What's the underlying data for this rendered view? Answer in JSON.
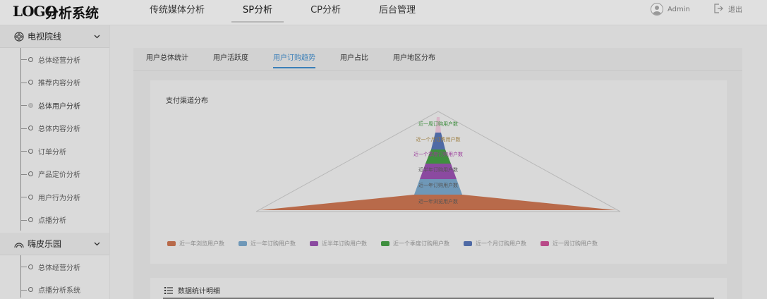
{
  "header": {
    "logo": "LOGO",
    "app_name": "分析系统",
    "nav": [
      "传统媒体分析",
      "SP分析",
      "CP分析",
      "后台管理"
    ],
    "nav_active_index": 1,
    "user": "Admin",
    "logout": "退出"
  },
  "sidebar": {
    "groups": [
      {
        "title": "电视院线",
        "icon": "film-reel-icon",
        "items": [
          "总体经营分析",
          "推荐内容分析",
          "总体用户分析",
          "总体内容分析",
          "订单分析",
          "产品定价分析",
          "用户行为分析",
          "点播分析"
        ],
        "active_index": 2
      },
      {
        "title": "嗨皮乐园",
        "icon": "rainbow-icon",
        "items": [
          "总体经营分析",
          "点播分析系统"
        ]
      }
    ]
  },
  "tabs": {
    "items": [
      "用户总体统计",
      "用户活跃度",
      "用户订购趋势",
      "用户占比",
      "用户地区分布"
    ],
    "active_index": 2
  },
  "chart_card": {
    "title": "支付渠道分布"
  },
  "detail_card": {
    "title": "数据统计明细",
    "icon": "list-icon"
  },
  "chart_data": {
    "type": "funnel",
    "title": "支付渠道分布",
    "stages": [
      {
        "name": "近一周订购用户数",
        "color": "#d9b8c9"
      },
      {
        "name": "近一个月订购用户数",
        "color": "#4f6aa5"
      },
      {
        "name": "近一个季度订购用户数",
        "color": "#3f8f3f"
      },
      {
        "name": "近半年订购用户数",
        "color": "#8b4aa0"
      },
      {
        "name": "近一年订购用户数",
        "color": "#6f98b8"
      },
      {
        "name": "近一年浏览用户数",
        "color": "#b86a4a"
      }
    ],
    "legend": {
      "placement": "bottom",
      "entries": [
        {
          "name": "近一年浏览用户数",
          "color": "#b86a4a"
        },
        {
          "name": "近一年订购用户数",
          "color": "#6f98b8"
        },
        {
          "name": "近半年订购用户数",
          "color": "#8b4aa0"
        },
        {
          "name": "近一个季度订购用户数",
          "color": "#3f8f3f"
        },
        {
          "name": "近一个月订购用户数",
          "color": "#4f6aa5"
        },
        {
          "name": "近一周订购用户数",
          "color": "#b84a88"
        }
      ]
    },
    "label_colors": {
      "近一周订购用户数": "#3a8a3a",
      "近一个月订购用户数": "#9a7a3a",
      "近一个季度订购用户数": "#9a3a9a",
      "近半年订购用户数": "#555555",
      "近一年订购用户数": "#555555",
      "近一年浏览用户数": "#555555"
    }
  }
}
